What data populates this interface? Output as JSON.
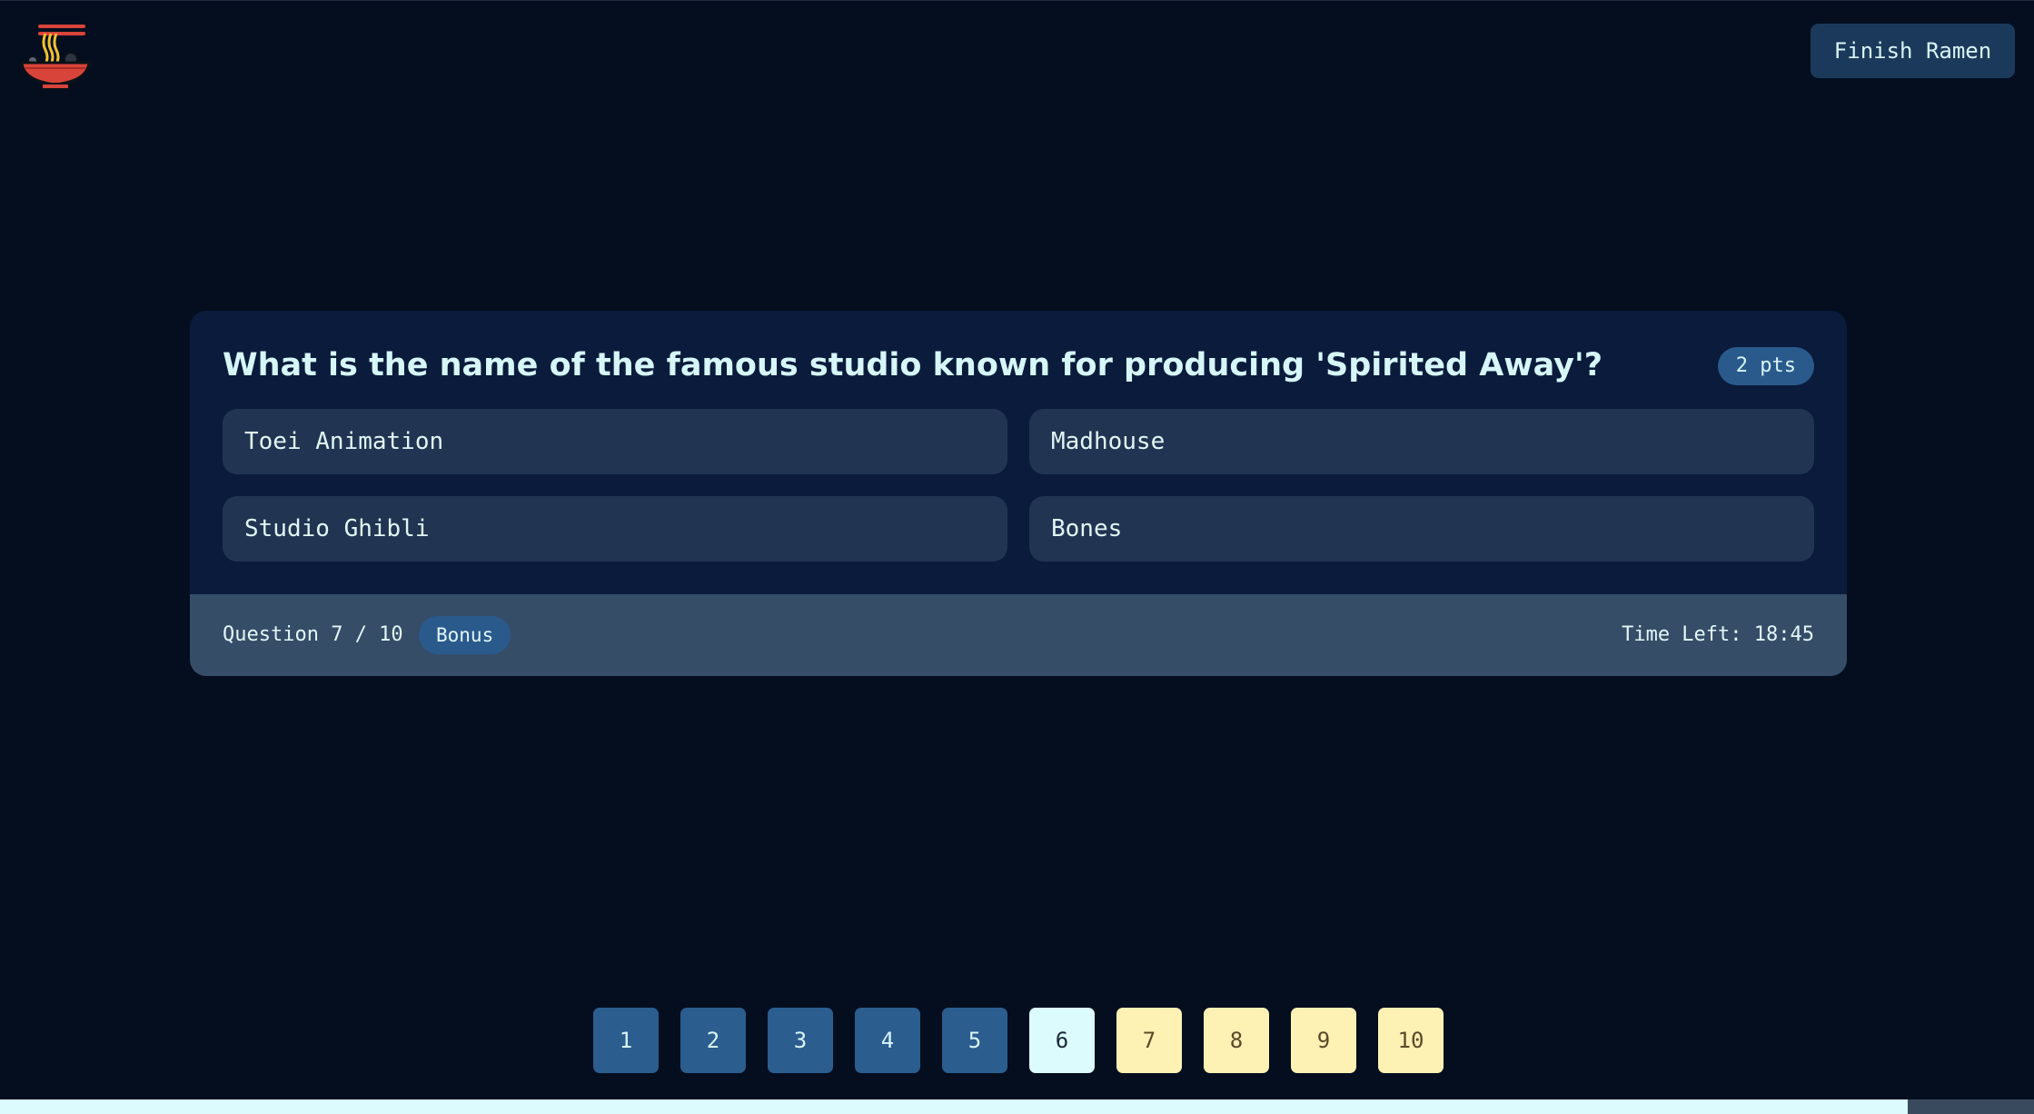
{
  "header": {
    "logo_icon": "ramen-bowl-icon",
    "finish_label": "Finish Ramen"
  },
  "quiz": {
    "question": "What is the name of the famous studio known for producing 'Spirited Away'?",
    "points": "2 pts",
    "options": [
      "Toei Animation",
      "Madhouse",
      "Studio Ghibli",
      "Bones"
    ],
    "counter": "Question 7 / 10",
    "tag": "Bonus",
    "timer": "Time Left: 18:45"
  },
  "navigator": {
    "items": [
      {
        "label": "1",
        "state": "answered"
      },
      {
        "label": "2",
        "state": "answered"
      },
      {
        "label": "3",
        "state": "answered"
      },
      {
        "label": "4",
        "state": "answered"
      },
      {
        "label": "5",
        "state": "answered"
      },
      {
        "label": "6",
        "state": "current"
      },
      {
        "label": "7",
        "state": "pending"
      },
      {
        "label": "8",
        "state": "pending"
      },
      {
        "label": "9",
        "state": "pending"
      },
      {
        "label": "10",
        "state": "pending"
      }
    ]
  },
  "progress": {
    "fraction": 0.938
  },
  "colors": {
    "background": "#040e1f",
    "card": "#0a1b3b",
    "accent": "#2a5a8c",
    "answered": "#2b5d8f",
    "current": "#dcfbfd",
    "pending": "#fdf1b4",
    "bowl": "#d9443a"
  }
}
